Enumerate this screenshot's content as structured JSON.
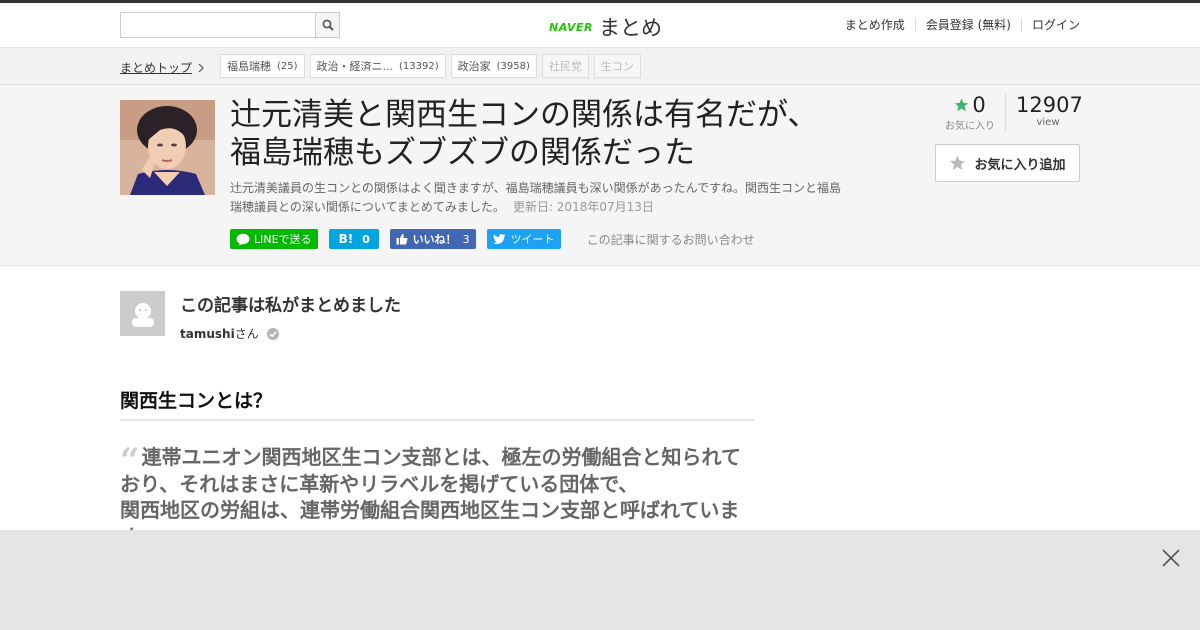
{
  "header": {
    "search_placeholder": "",
    "logo_brand": "NAVER",
    "logo_text": "まとめ",
    "nav": [
      "まとめ作成",
      "会員登録 (無料)",
      "ログイン"
    ]
  },
  "breadcrumb": {
    "top_label": "まとめトップ",
    "tags": [
      {
        "label": "福島瑞穂",
        "count": "(25)"
      },
      {
        "label": "政治・経済ニ...",
        "count": "(13392)"
      },
      {
        "label": "政治家",
        "count": "(3958)"
      },
      {
        "label": "社民党",
        "count": ""
      },
      {
        "label": "生コン",
        "count": ""
      }
    ]
  },
  "article": {
    "title_line1": "辻元清美と関西生コンの関係は有名だが、",
    "title_line2": "福島瑞穂もズブズブの関係だった",
    "description": "辻元清美議員の生コンとの関係はよく聞きますが、福島瑞穂議員も深い関係があったんですね。関西生コンと福島瑞穂議員との深い関係についてまとめてみました。",
    "updated": "更新日: 2018年07月13日",
    "favorites_count": "0",
    "favorites_label": "お気に入り",
    "views_count": "12907",
    "views_label": "view",
    "fav_button_label": "お気に入り追加"
  },
  "share": {
    "line_label": "LINEで送る",
    "hatena_label": "B!",
    "hatena_count": "0",
    "like_label": "いいね！",
    "like_count": "3",
    "tweet_label": "ツイート",
    "inquiry_label": "この記事に関するお問い合わせ"
  },
  "author": {
    "heading": "この記事は私がまとめました",
    "name": "tamushi",
    "suffix": "さん"
  },
  "content": {
    "section_heading": "関西生コンとは？",
    "quote_line1": "連帯ユニオン関西地区生コン支部とは、極左の労働組合と知られて",
    "quote_line2": "おり、それはまさに革新やリラベルを掲げている団体で、",
    "quote_line3": "関西地区の労組は、連帯労働組合関西地区生コン支部と呼ばれていま",
    "quote_line4": "す。"
  },
  "colors": {
    "line": "#00b900",
    "hatena": "#00a4de",
    "facebook": "#4267b2",
    "twitter": "#1da1f2",
    "fav_star": "#3cb371",
    "naver_green": "#1ec800"
  }
}
